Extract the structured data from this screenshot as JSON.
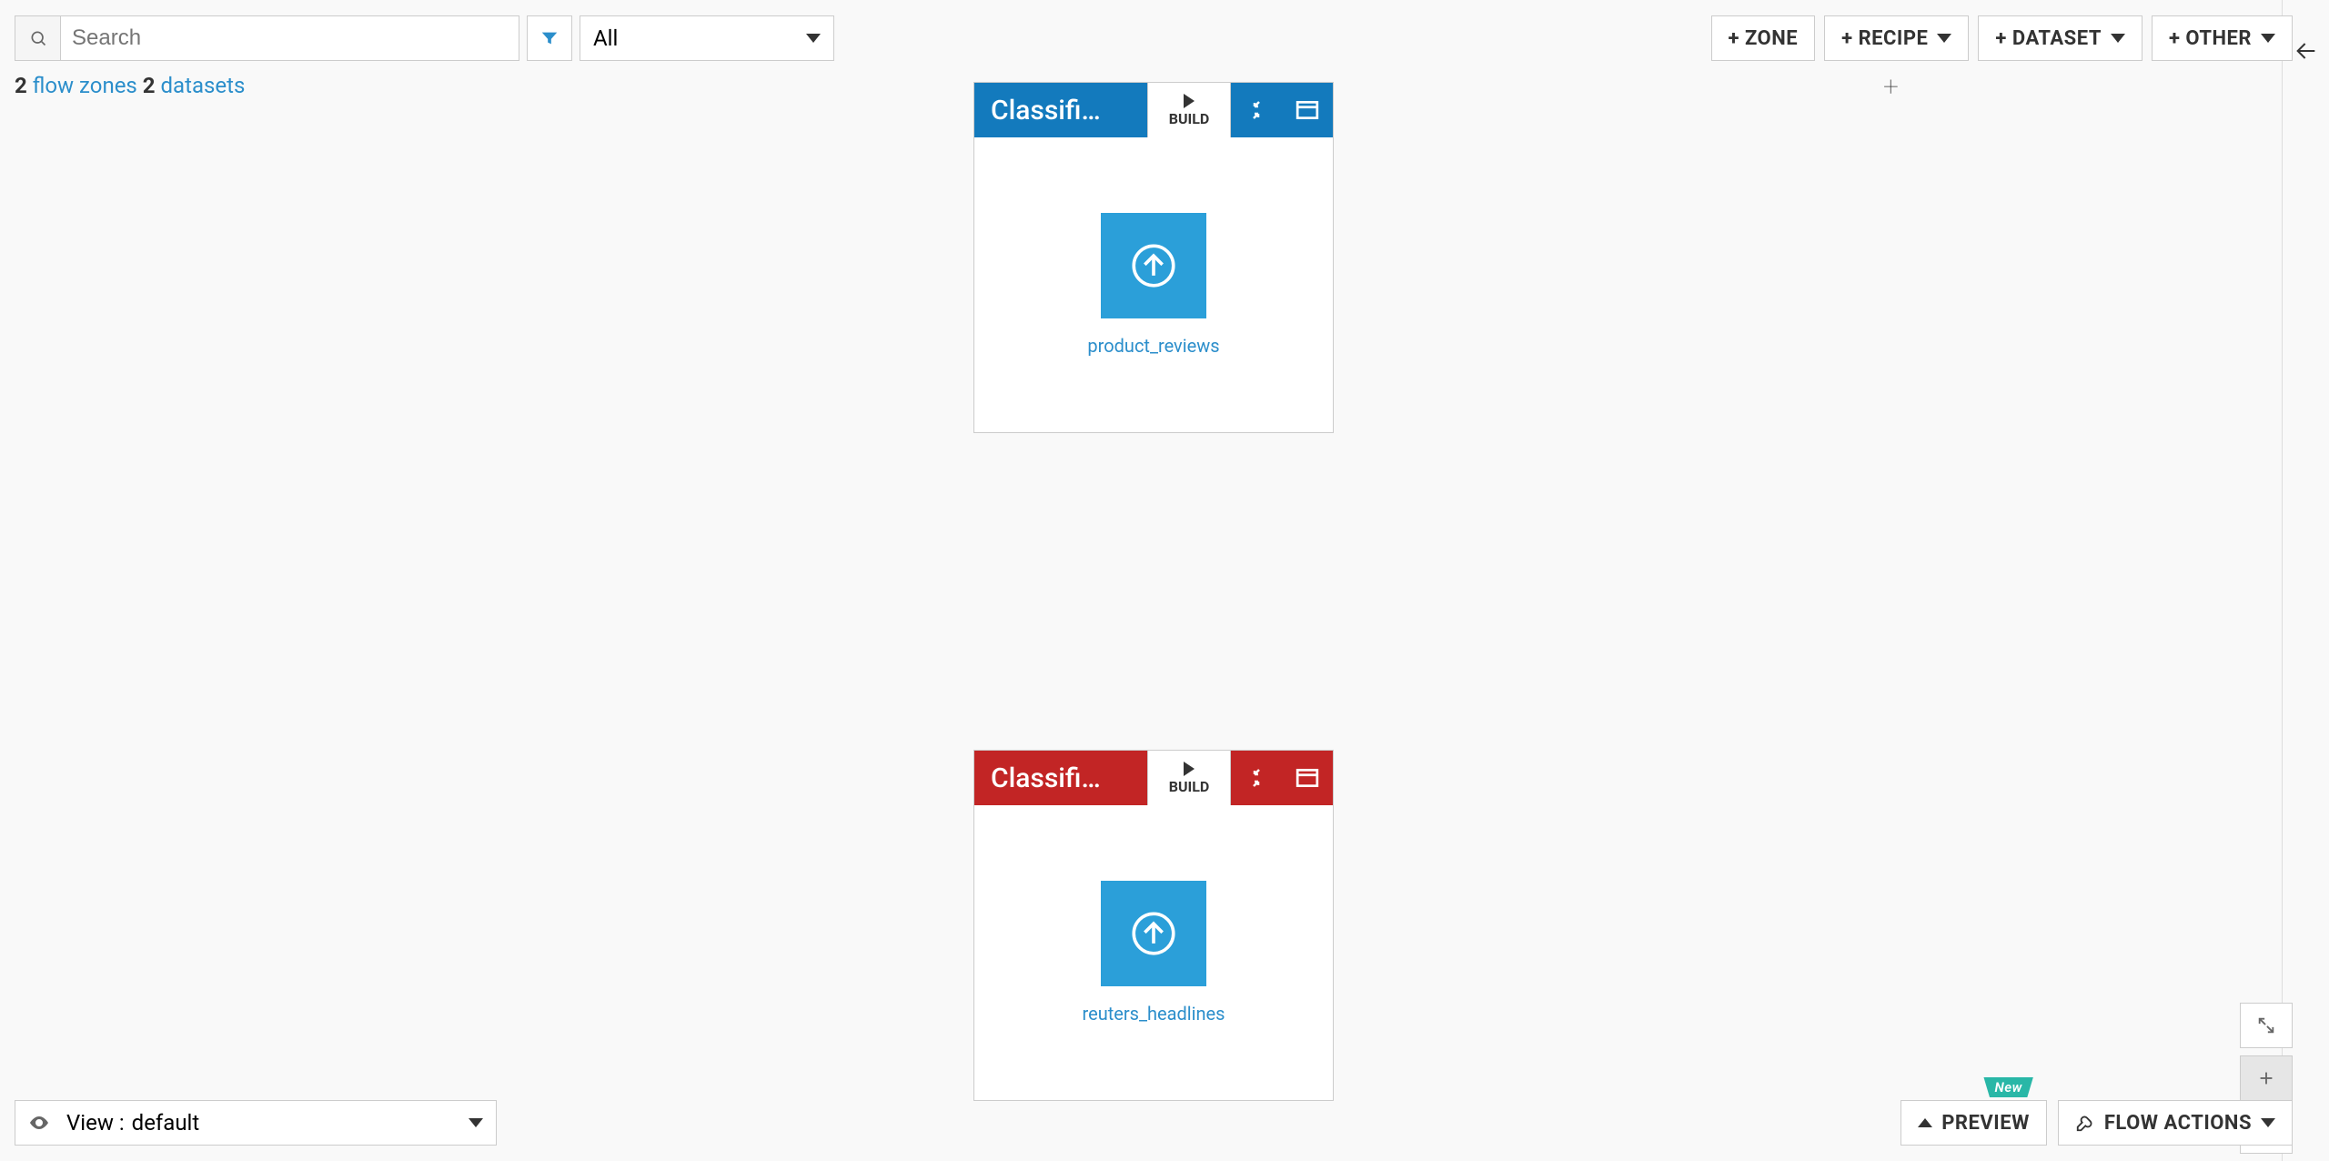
{
  "search": {
    "placeholder": "Search"
  },
  "filter": {
    "selected": "All"
  },
  "topButtons": {
    "zone": "+ ZONE",
    "recipe": "+ RECIPE",
    "dataset": "+ DATASET",
    "other": "+ OTHER"
  },
  "stats": {
    "zones_count": "2",
    "zones_label": "flow zones",
    "datasets_count": "2",
    "datasets_label": "datasets"
  },
  "zones": [
    {
      "title": "Classifi…",
      "build": "BUILD",
      "dataset": "product_reviews",
      "color": "blue"
    },
    {
      "title": "Classifi…",
      "build": "BUILD",
      "dataset": "reuters_headlines",
      "color": "red"
    }
  ],
  "bottom": {
    "view_prefix": "View :",
    "view_name": "default",
    "preview": "PREVIEW",
    "flow_actions": "FLOW ACTIONS",
    "new_badge": "New"
  }
}
